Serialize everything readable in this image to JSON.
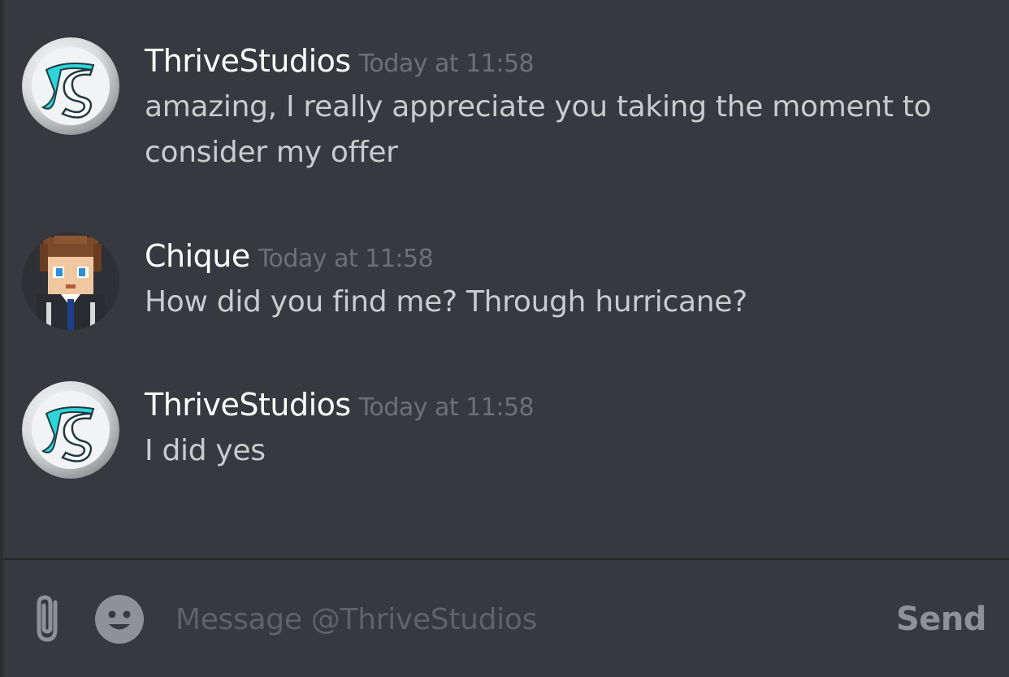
{
  "messages": [
    {
      "username": "ThriveStudios",
      "timestamp": "Today at 11:58",
      "text": "amazing, I really appreciate you taking the moment to consider my offer",
      "avatar": "thrivestudios-logo-icon"
    },
    {
      "username": "Chique",
      "timestamp": "Today at 11:58",
      "text": "How did you find me? Through hurricane?",
      "avatar": "chique-character-icon"
    },
    {
      "username": "ThriveStudios",
      "timestamp": "Today at 11:58",
      "text": "I did yes",
      "avatar": "thrivestudios-logo-icon"
    }
  ],
  "composer": {
    "placeholder": "Message @ThriveStudios",
    "send_label": "Send",
    "attach_icon": "paperclip-icon",
    "emoji_icon": "smiley-icon"
  },
  "colors": {
    "background": "#36393f",
    "username": "#ffffff",
    "timestamp": "#6d7077",
    "message_text": "#c9cbce",
    "logo_accent": "#2fd4d8"
  }
}
